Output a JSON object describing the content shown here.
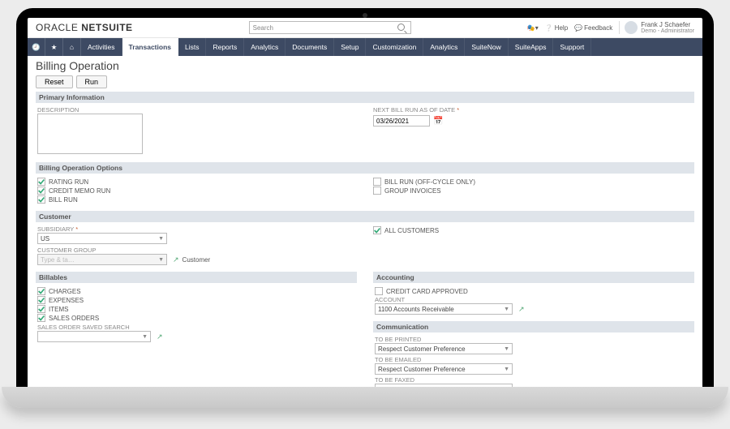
{
  "brand": {
    "prefix": "ORACLE",
    "suffix": "NETSUITE"
  },
  "search": {
    "placeholder": "Search"
  },
  "topbar": {
    "help": "Help",
    "feedback": "Feedback",
    "user_name": "Frank J Schaefer",
    "user_role": "Demo - Administrator"
  },
  "nav": {
    "items": [
      "Activities",
      "Transactions",
      "Lists",
      "Reports",
      "Analytics",
      "Documents",
      "Setup",
      "Customization",
      "Analytics",
      "SuiteNow",
      "SuiteApps",
      "Support"
    ],
    "active_index": 1
  },
  "page_title": "Billing Operation",
  "buttons": {
    "reset": "Reset",
    "run": "Run"
  },
  "sections": {
    "primary": {
      "title": "Primary Information",
      "description_label": "DESCRIPTION",
      "next_bill_run_label": "NEXT BILL RUN AS OF DATE",
      "next_bill_run_value": "03/26/2021"
    },
    "options": {
      "title": "Billing Operation Options",
      "rating_run": "RATING RUN",
      "credit_memo_run": "CREDIT MEMO RUN",
      "bill_run": "BILL RUN",
      "off_cycle": "BILL RUN (OFF-CYCLE ONLY)",
      "group_invoices": "GROUP INVOICES"
    },
    "customer": {
      "title": "Customer",
      "subsidiary_label": "SUBSIDIARY",
      "subsidiary_value": "US",
      "customer_group_label": "CUSTOMER GROUP",
      "customer_group_hint": "Type & ta…",
      "customer_link": "Customer",
      "all_customers": "ALL CUSTOMERS"
    },
    "billables": {
      "title": "Billables",
      "charges": "CHARGES",
      "expenses": "EXPENSES",
      "items": "ITEMS",
      "sales_orders": "SALES ORDERS",
      "sos_search_label": "SALES ORDER SAVED SEARCH"
    },
    "accounting": {
      "title": "Accounting",
      "cc_approved": "CREDIT CARD APPROVED",
      "account_label": "ACCOUNT",
      "account_value": "1100 Accounts Receivable"
    },
    "communication": {
      "title": "Communication",
      "printed_label": "TO BE PRINTED",
      "emailed_label": "TO BE EMAILED",
      "faxed_label": "TO BE FAXED",
      "pref_value": "Respect Customer Preference"
    }
  }
}
